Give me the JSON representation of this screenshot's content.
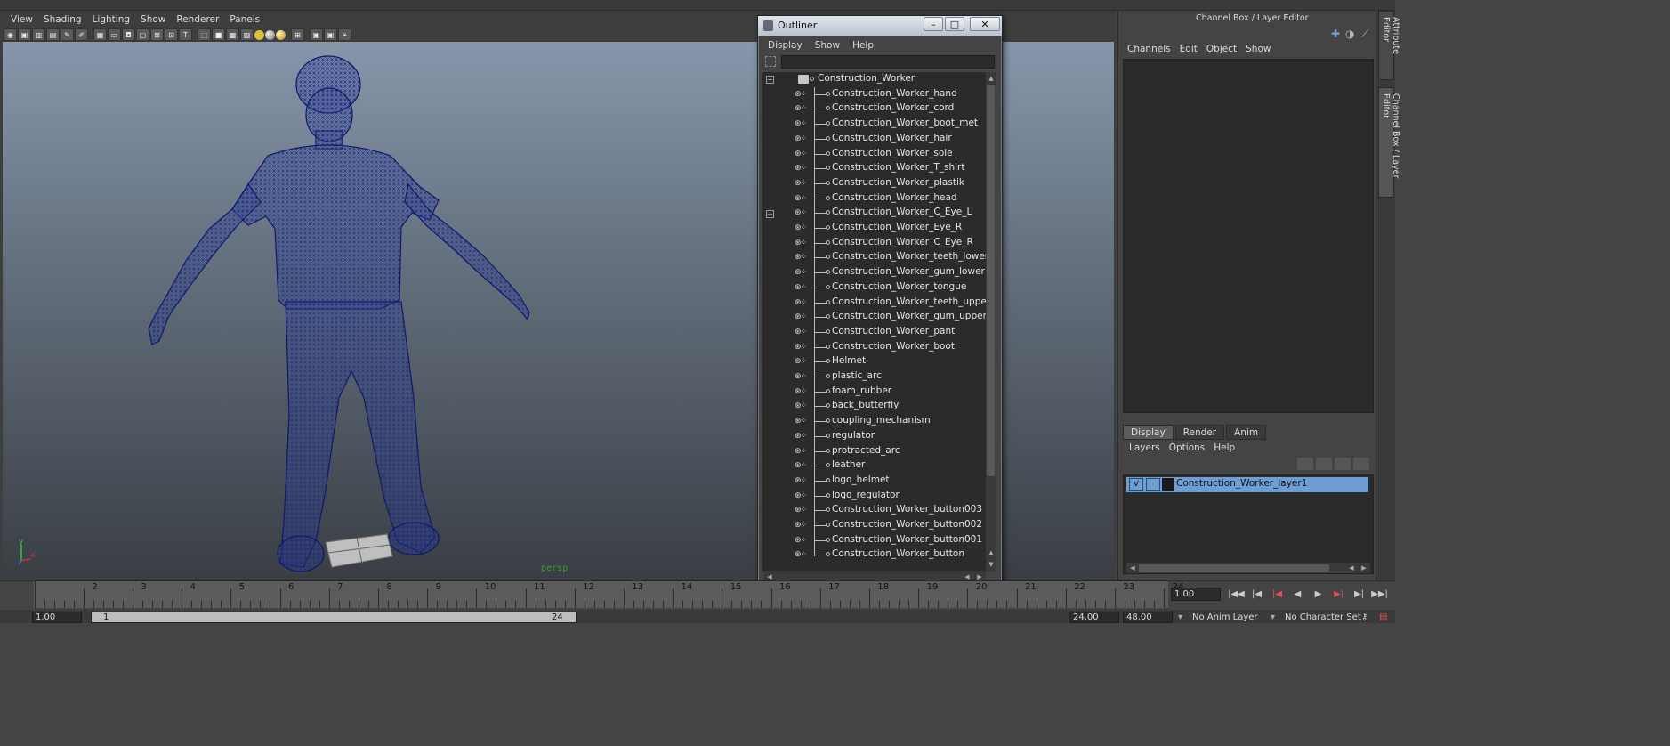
{
  "viewport": {
    "menu": [
      "View",
      "Shading",
      "Lighting",
      "Show",
      "Renderer",
      "Panels"
    ],
    "camera_label": "persp",
    "axis_y": "y",
    "axis_x": "x"
  },
  "outliner": {
    "title": "Outliner",
    "menu": [
      "Display",
      "Show",
      "Help"
    ],
    "filter_value": "",
    "root": "Construction_Worker",
    "items": [
      "Construction_Worker_hand",
      "Construction_Worker_cord",
      "Construction_Worker_boot_met",
      "Construction_Worker_hair",
      "Construction_Worker_sole",
      "Construction_Worker_T_shirt",
      "Construction_Worker_plastik",
      "Construction_Worker_head",
      "Construction_Worker_C_Eye_L",
      "Construction_Worker_Eye_R",
      "Construction_Worker_C_Eye_R",
      "Construction_Worker_teeth_lower",
      "Construction_Worker_gum_lower",
      "Construction_Worker_tongue",
      "Construction_Worker_teeth_upper",
      "Construction_Worker_gum_upper",
      "Construction_Worker_pant",
      "Construction_Worker_boot",
      "Helmet",
      "plastic_arc",
      "foam_rubber",
      "back_butterfly",
      "coupling_mechanism",
      "regulator",
      "protracted_arc",
      "leather",
      "logo_helmet",
      "logo_regulator",
      "Construction_Worker_button003",
      "Construction_Worker_button002",
      "Construction_Worker_button001",
      "Construction_Worker_button"
    ]
  },
  "channel_box": {
    "title": "Channel Box / Layer Editor",
    "menu": [
      "Channels",
      "Edit",
      "Object",
      "Show"
    ],
    "tabs": [
      "Display",
      "Render",
      "Anim"
    ],
    "active_tab": "Display",
    "layer_menu": [
      "Layers",
      "Options",
      "Help"
    ],
    "layer": {
      "visible": "V",
      "name": "Construction_Worker_layer1"
    },
    "side_tabs": [
      "Attribute Editor",
      "Channel Box / Layer Editor"
    ]
  },
  "timeline": {
    "ticks": [
      "2",
      "3",
      "4",
      "5",
      "6",
      "7",
      "8",
      "9",
      "10",
      "11",
      "12",
      "13",
      "14",
      "15",
      "16",
      "17",
      "18",
      "19",
      "20",
      "21",
      "22",
      "23",
      "24"
    ],
    "current_frame": "1.00"
  },
  "range": {
    "start": "1.00",
    "bar_start": "1",
    "bar_end": "24",
    "end_field": "24.00",
    "max_field": "48.00",
    "anim_layer": "No Anim Layer",
    "character_set": "No Character Set"
  }
}
